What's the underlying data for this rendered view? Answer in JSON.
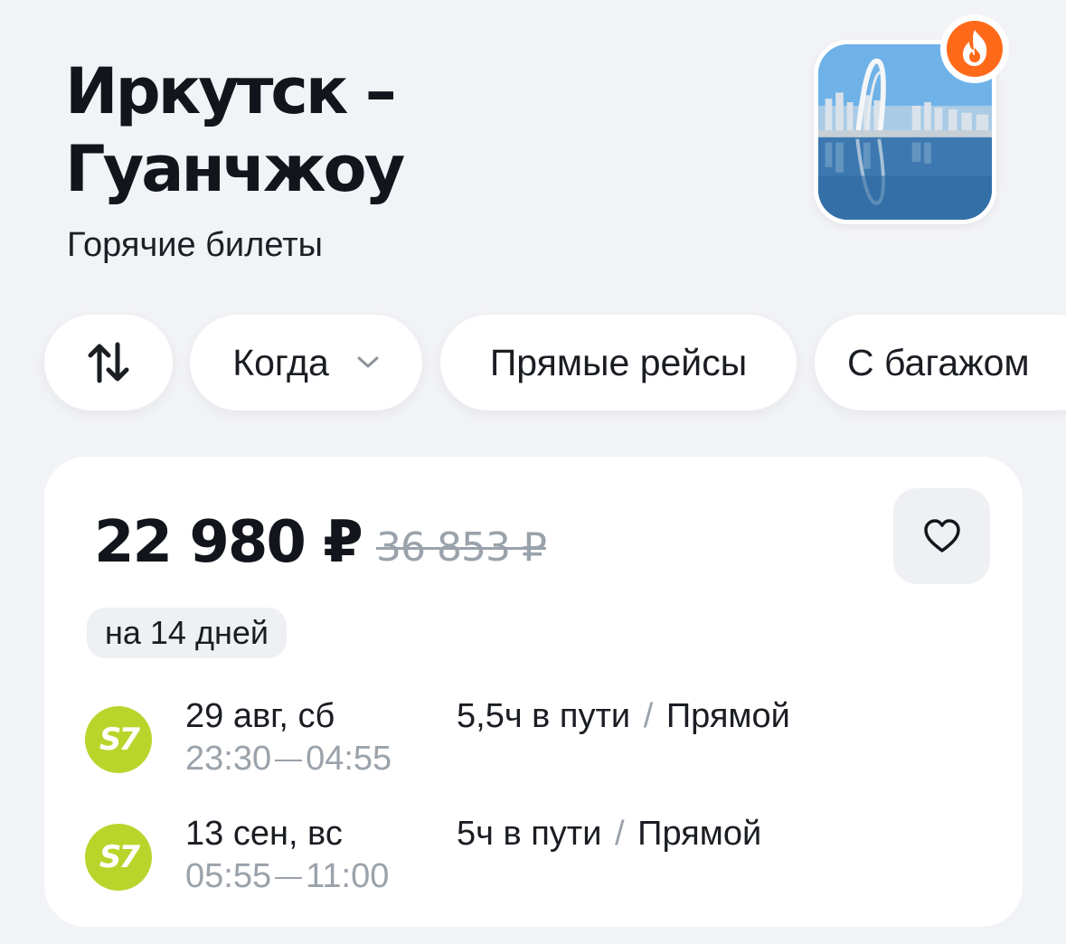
{
  "header": {
    "title_line1": "Иркутск –",
    "title_line2": "Гуанчжоу",
    "subtitle": "Горячие билеты",
    "hot_icon": "fire-icon"
  },
  "filters": {
    "swap_icon": "swap-arrows-icon",
    "when_label": "Когда",
    "direct_label": "Прямые рейсы",
    "baggage_label": "С багажом"
  },
  "offer": {
    "price": "22 980 ₽",
    "old_price": "36 853 ₽",
    "favorite_icon": "heart-icon",
    "duration": "на 14 дней",
    "flights": [
      {
        "airline": "S7",
        "date": "29 авг, сб",
        "depart": "23:30",
        "arrive": "04:55",
        "travel_time": "5,5ч в пути",
        "separator": "/",
        "type": "Прямой"
      },
      {
        "airline": "S7",
        "date": "13 сен, вс",
        "depart": "05:55",
        "arrive": "11:00",
        "travel_time": "5ч в пути",
        "separator": "/",
        "type": "Прямой"
      }
    ]
  },
  "colors": {
    "background": "#f2f3f6",
    "accent_fire": "#ff6a1a",
    "s7_green": "#b9d52c",
    "muted_text": "#9aa2ab"
  }
}
